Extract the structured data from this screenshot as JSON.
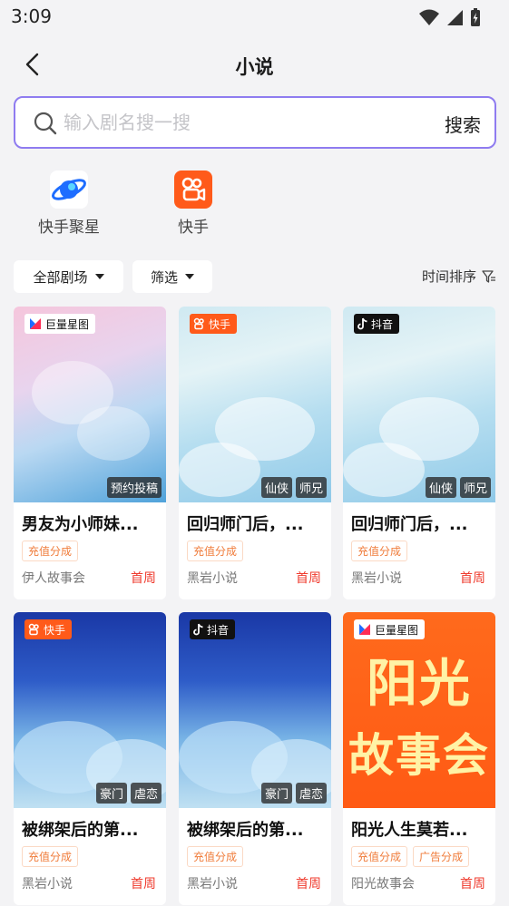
{
  "status_bar": {
    "time": "3:09"
  },
  "header": {
    "title": "小说"
  },
  "search": {
    "placeholder": "输入剧名搜一搜",
    "submit_label": "搜索"
  },
  "platforms": [
    {
      "label": "快手聚星",
      "icon": "planet-icon"
    },
    {
      "label": "快手",
      "icon": "kuaishou-camera-icon"
    }
  ],
  "filters": {
    "theater": "全部剧场",
    "filter": "筛选",
    "sort": "时间排序"
  },
  "cards": [
    {
      "platform": "巨量星图",
      "tags": [
        "预约投稿"
      ],
      "title": "男友为小师妹...",
      "chips": [
        "充值分成"
      ],
      "publisher": "伊人故事会",
      "period": "首周"
    },
    {
      "platform": "快手",
      "tags": [
        "仙侠",
        "师兄"
      ],
      "title": "回归师门后，...",
      "chips": [
        "充值分成"
      ],
      "publisher": "黑岩小说",
      "period": "首周"
    },
    {
      "platform": "抖音",
      "tags": [
        "仙侠",
        "师兄"
      ],
      "title": "回归师门后，...",
      "chips": [
        "充值分成"
      ],
      "publisher": "黑岩小说",
      "period": "首周"
    },
    {
      "platform": "快手",
      "tags": [
        "豪门",
        "虐恋"
      ],
      "title": "被绑架后的第...",
      "chips": [
        "充值分成"
      ],
      "publisher": "黑岩小说",
      "period": "首周"
    },
    {
      "platform": "抖音",
      "tags": [
        "豪门",
        "虐恋"
      ],
      "title": "被绑架后的第...",
      "chips": [
        "充值分成"
      ],
      "publisher": "黑岩小说",
      "period": "首周"
    },
    {
      "platform": "巨量星图",
      "cover_text": [
        "阳光",
        "故事会"
      ],
      "tags": [],
      "title": "阳光人生莫若...",
      "chips": [
        "充值分成",
        "广告分成"
      ],
      "publisher": "阳光故事会",
      "period": "首周"
    }
  ],
  "colors": {
    "accent_border": "#8f7cf0",
    "kuaishou": "#ff5a1a",
    "period_red": "#ef3b2e",
    "chip_orange": "#f07d3c"
  }
}
